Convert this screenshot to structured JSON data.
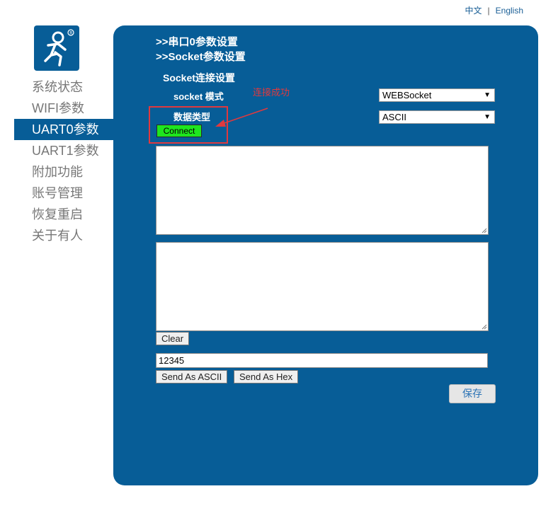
{
  "header": {
    "lang_zh": "中文",
    "separator": "|",
    "lang_en": "English"
  },
  "logo": {
    "icon": "usr-person-logo-icon",
    "brand_color": "#075d97"
  },
  "nav": {
    "items": [
      {
        "label": "系统状态"
      },
      {
        "label": "WIFI参数"
      },
      {
        "label": "UART0参数",
        "active": true
      },
      {
        "label": "UART1参数"
      },
      {
        "label": "附加功能"
      },
      {
        "label": "账号管理"
      },
      {
        "label": "恢复重启"
      },
      {
        "label": "关于有人"
      }
    ]
  },
  "panel": {
    "heading1": ">>串口0参数设置",
    "heading2": ">>Socket参数设置",
    "socket_section_title": "Socket连接设置",
    "socket_mode_label": "socket 模式",
    "socket_mode_value": "WEBSocket",
    "data_type_label": "数据类型",
    "data_type_value": "ASCII",
    "connect_label": "Connect",
    "clear_label": "Clear",
    "send_input_value": "12345",
    "send_ascii_label": "Send As ASCII",
    "send_hex_label": "Send As Hex",
    "save_label": "保存"
  },
  "annotation": {
    "text": "连接成功",
    "color": "#e0393e"
  },
  "colors": {
    "panel_bg": "#075d97",
    "connect_bg": "#1ee61e"
  }
}
